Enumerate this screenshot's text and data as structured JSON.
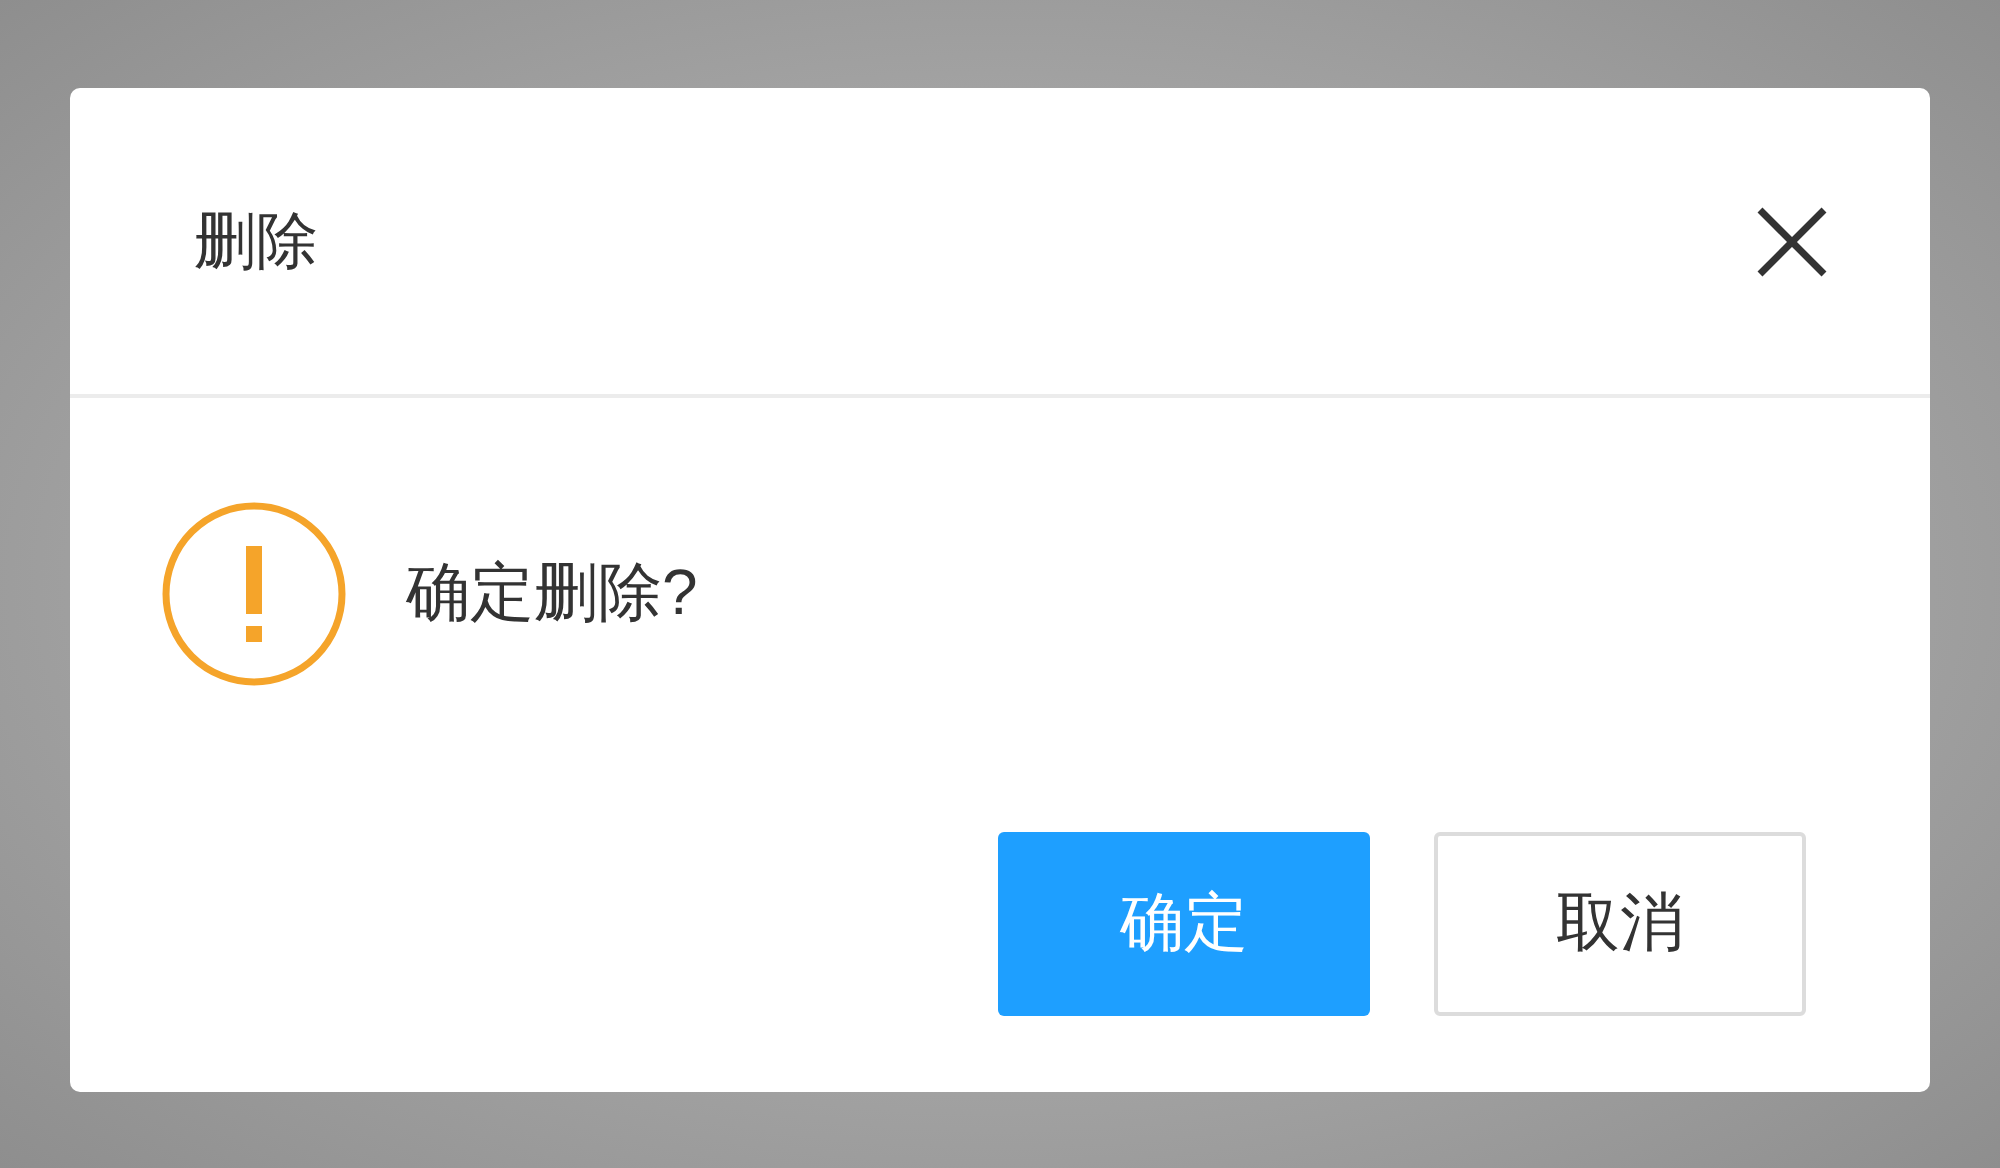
{
  "dialog": {
    "title": "删除",
    "message": "确定删除?",
    "buttons": [
      {
        "label": "确定",
        "kind": "primary"
      },
      {
        "label": "取消",
        "kind": "secondary"
      }
    ]
  }
}
